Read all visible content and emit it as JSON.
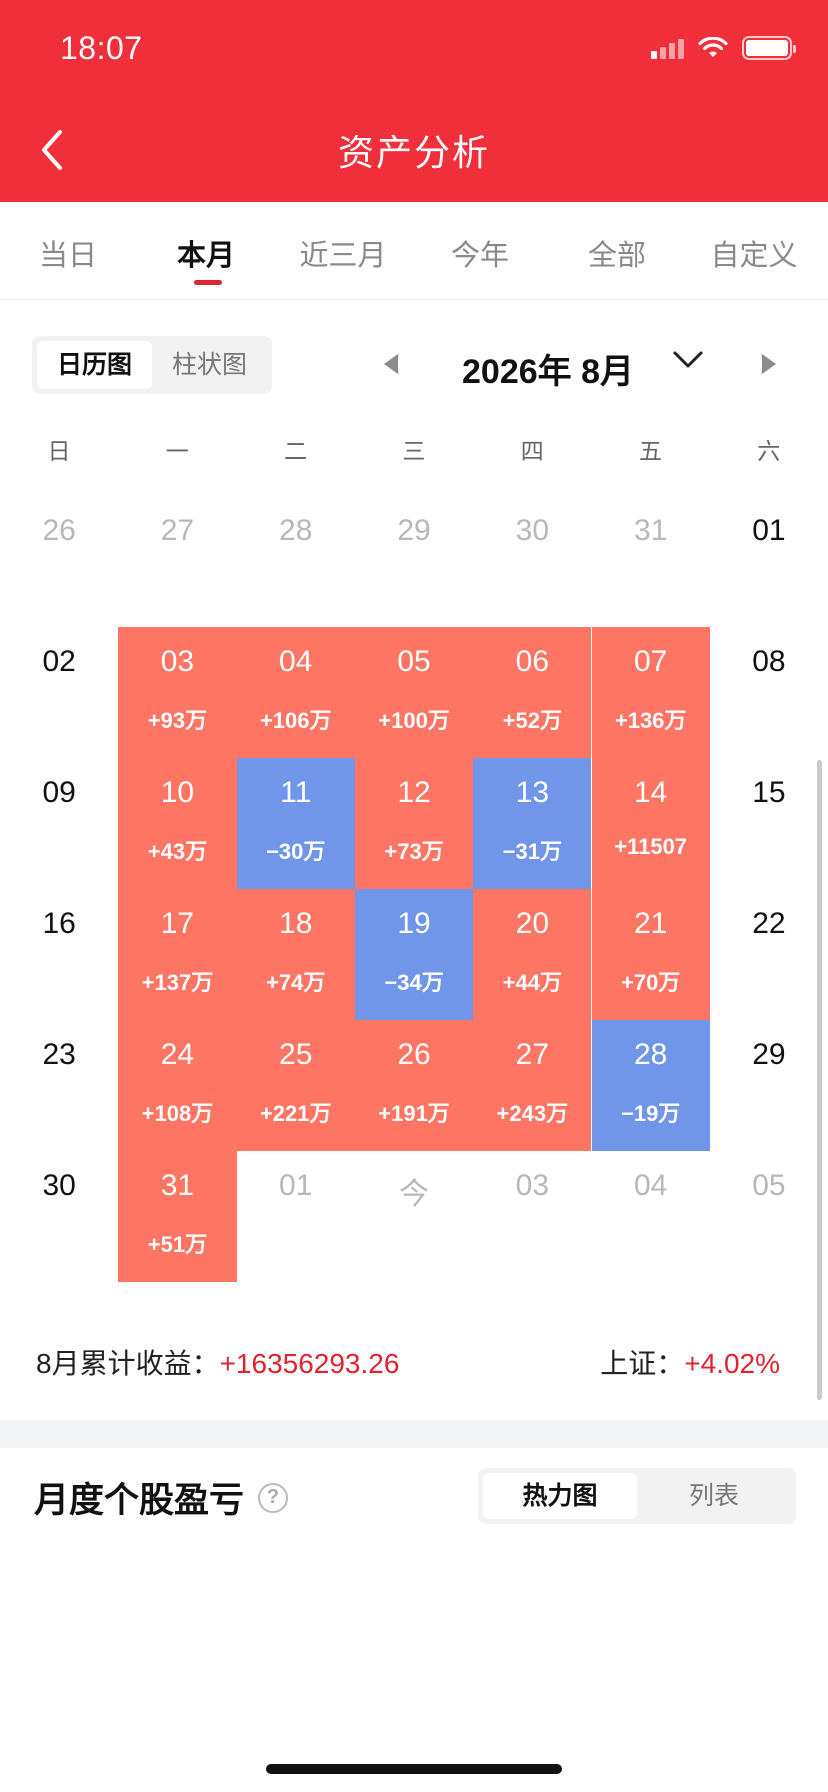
{
  "status_bar": {
    "time": "18:07"
  },
  "header": {
    "title": "资产分析",
    "accent": "#F02F3B"
  },
  "tabs": [
    {
      "label": "当日"
    },
    {
      "label": "本月",
      "active": true
    },
    {
      "label": "近三月"
    },
    {
      "label": "今年"
    },
    {
      "label": "全部"
    },
    {
      "label": "自定义"
    }
  ],
  "view_toggle": {
    "options": [
      "日历图",
      "柱状图"
    ],
    "selected": "日历图"
  },
  "month_nav": {
    "label": "2026年 8月"
  },
  "weekdays": [
    "日",
    "一",
    "二",
    "三",
    "四",
    "五",
    "六"
  ],
  "colors": {
    "profit": "#FF7563",
    "loss": "#7195E8",
    "profit_text": "#E0232F"
  },
  "calendar": [
    [
      {
        "day": "26",
        "state": "other"
      },
      {
        "day": "27",
        "state": "other"
      },
      {
        "day": "28",
        "state": "other"
      },
      {
        "day": "29",
        "state": "other"
      },
      {
        "day": "30",
        "state": "other"
      },
      {
        "day": "31",
        "state": "other"
      },
      {
        "day": "01",
        "state": "none"
      }
    ],
    [
      {
        "day": "02",
        "state": "none"
      },
      {
        "day": "03",
        "value": "+93万",
        "state": "pos"
      },
      {
        "day": "04",
        "value": "+106万",
        "state": "pos"
      },
      {
        "day": "05",
        "value": "+100万",
        "state": "pos"
      },
      {
        "day": "06",
        "value": "+52万",
        "state": "pos"
      },
      {
        "day": "07",
        "value": "+136万",
        "state": "pos"
      },
      {
        "day": "08",
        "state": "none"
      }
    ],
    [
      {
        "day": "09",
        "state": "none"
      },
      {
        "day": "10",
        "value": "+43万",
        "state": "pos"
      },
      {
        "day": "11",
        "value": "−30万",
        "state": "neg"
      },
      {
        "day": "12",
        "value": "+73万",
        "state": "pos"
      },
      {
        "day": "13",
        "value": "−31万",
        "state": "neg"
      },
      {
        "day": "14",
        "value": "+11507",
        "state": "pos"
      },
      {
        "day": "15",
        "state": "none"
      }
    ],
    [
      {
        "day": "16",
        "state": "none"
      },
      {
        "day": "17",
        "value": "+137万",
        "state": "pos"
      },
      {
        "day": "18",
        "value": "+74万",
        "state": "pos"
      },
      {
        "day": "19",
        "value": "−34万",
        "state": "neg"
      },
      {
        "day": "20",
        "value": "+44万",
        "state": "pos"
      },
      {
        "day": "21",
        "value": "+70万",
        "state": "pos"
      },
      {
        "day": "22",
        "state": "none"
      }
    ],
    [
      {
        "day": "23",
        "state": "none"
      },
      {
        "day": "24",
        "value": "+108万",
        "state": "pos"
      },
      {
        "day": "25",
        "value": "+221万",
        "state": "pos"
      },
      {
        "day": "26",
        "value": "+191万",
        "state": "pos"
      },
      {
        "day": "27",
        "value": "+243万",
        "state": "pos"
      },
      {
        "day": "28",
        "value": "−19万",
        "state": "neg"
      },
      {
        "day": "29",
        "state": "none"
      }
    ],
    [
      {
        "day": "30",
        "state": "none"
      },
      {
        "day": "31",
        "value": "+51万",
        "state": "pos"
      },
      {
        "day": "01",
        "state": "other"
      },
      {
        "day": "今",
        "state": "other"
      },
      {
        "day": "03",
        "state": "other"
      },
      {
        "day": "04",
        "state": "other"
      },
      {
        "day": "05",
        "state": "other"
      }
    ]
  ],
  "summary": {
    "label": "8月累计收益：",
    "value": "+16356293.26",
    "index_label": "上证：",
    "index_value": "+4.02%"
  },
  "section": {
    "title": "月度个股盈亏",
    "help": "?",
    "toggle": [
      "热力图",
      "列表"
    ],
    "selected": "热力图"
  }
}
